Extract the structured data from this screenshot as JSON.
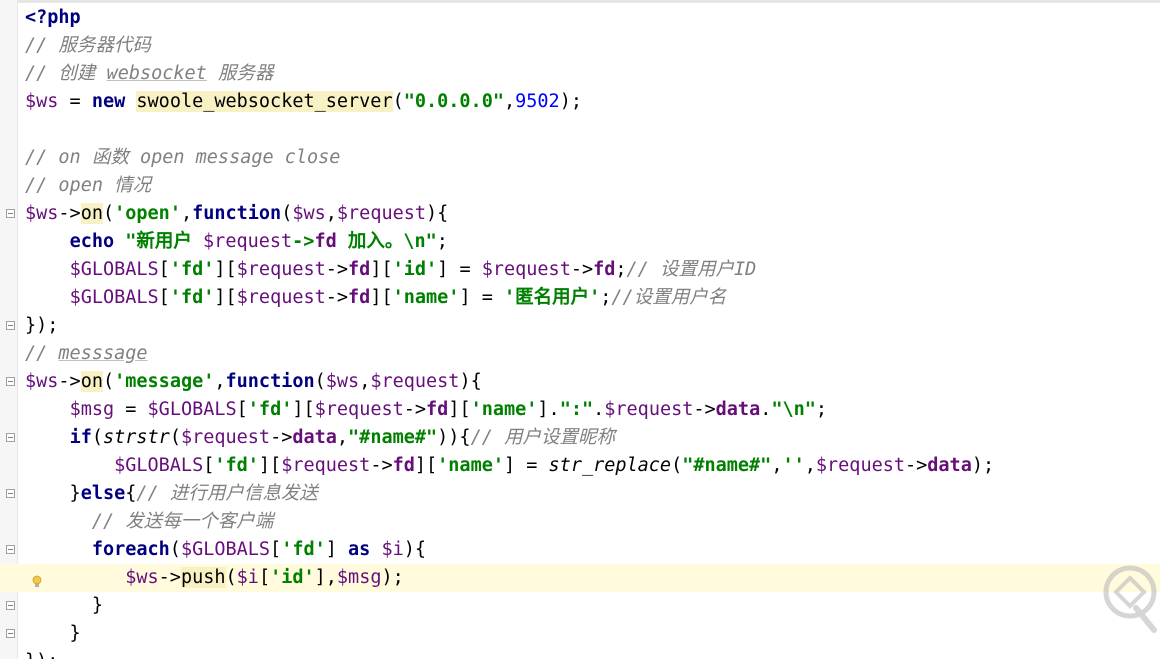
{
  "editor": {
    "language": "php",
    "current_line_index": 20,
    "lines": [
      "<?php",
      "// 服务器代码",
      "// 创建 websocket 服务器",
      "$ws = new swoole_websocket_server(\"0.0.0.0\",9502);",
      "",
      "// on 函数 open message close",
      "// open 情况",
      "$ws->on('open',function($ws,$request){",
      "    echo \"新用户 $request->fd 加入。\\n\";",
      "    $GLOBALS['fd'][$request->fd]['id'] = $request->fd;// 设置用户ID",
      "    $GLOBALS['fd'][$request->fd]['name'] = '匿名用户';//设置用户名",
      "});",
      "// messsage",
      "$ws->on('message',function($ws,$request){",
      "    $msg = $GLOBALS['fd'][$request->fd]['name'].\":\".$request->data.\"\\n\";",
      "    if(strstr($request->data,\"#name#\")){// 用户设置昵称",
      "        $GLOBALS['fd'][$request->fd]['name'] = str_replace(\"#name#\",'',$request->data);",
      "    }else{// 进行用户信息发送",
      "        // 发送每一个客户端",
      "        foreach($GLOBALS['fd'] as $i){",
      "            $ws->push($i['id'],$msg);",
      "        }",
      "    }",
      "});"
    ]
  },
  "icons": {
    "fold_open": "fold-open-icon",
    "fold_close": "fold-close-icon",
    "intention": "lightbulb-icon",
    "watermark": "watermark-logo"
  },
  "colors": {
    "keyword": "#000080",
    "variable": "#660e7a",
    "string": "#008000",
    "number": "#0000ff",
    "comment": "#808080",
    "current_line": "#fffbdc"
  }
}
